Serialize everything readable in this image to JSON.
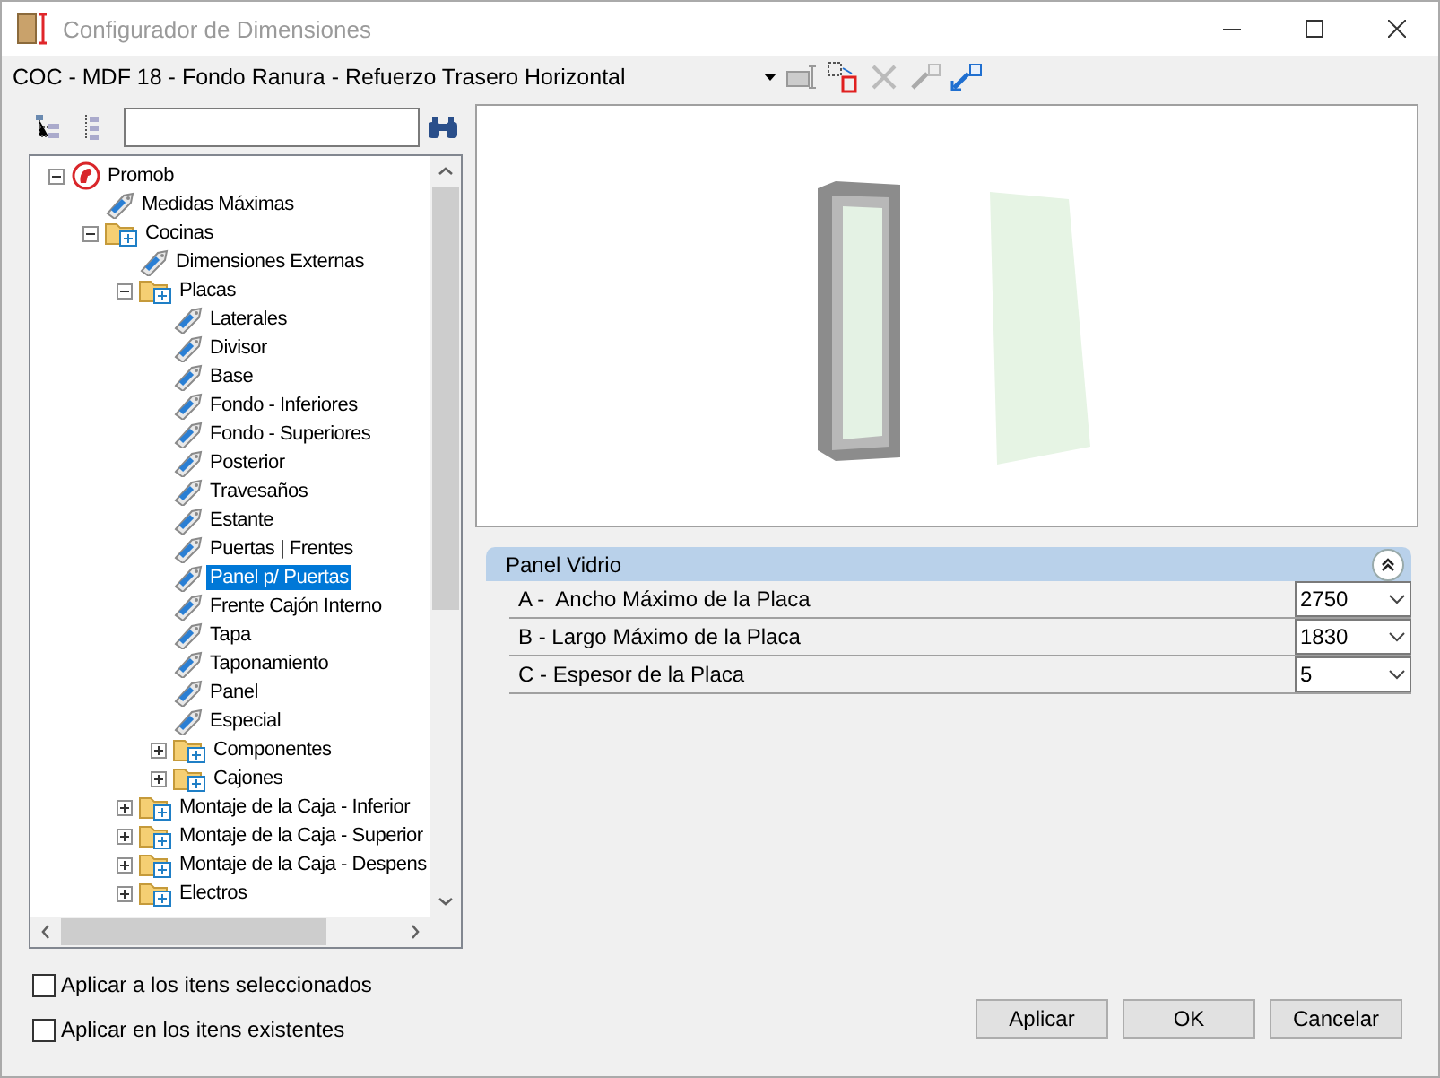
{
  "window": {
    "title": "Configurador de Dimensiones"
  },
  "configuration": {
    "value": "COC - MDF 18 - Fondo Ranura - Refuerzo Trasero Horizontal"
  },
  "tree": {
    "items": [
      {
        "label": "Promob",
        "kind": "root",
        "expanded": true,
        "selected": false,
        "children": [
          {
            "label": "Medidas Máximas",
            "kind": "item",
            "selected": false
          },
          {
            "label": "Cocinas",
            "kind": "folder",
            "expanded": true,
            "selected": false,
            "children": [
              {
                "label": "Dimensiones Externas",
                "kind": "item",
                "selected": false
              },
              {
                "label": "Placas",
                "kind": "folder",
                "expanded": true,
                "selected": false,
                "children": [
                  {
                    "label": "Laterales",
                    "kind": "item",
                    "selected": false
                  },
                  {
                    "label": "Divisor",
                    "kind": "item",
                    "selected": false
                  },
                  {
                    "label": "Base",
                    "kind": "item",
                    "selected": false
                  },
                  {
                    "label": "Fondo - Inferiores",
                    "kind": "item",
                    "selected": false
                  },
                  {
                    "label": "Fondo - Superiores",
                    "kind": "item",
                    "selected": false
                  },
                  {
                    "label": "Posterior",
                    "kind": "item",
                    "selected": false
                  },
                  {
                    "label": "Travesaños",
                    "kind": "item",
                    "selected": false
                  },
                  {
                    "label": "Estante",
                    "kind": "item",
                    "selected": false
                  },
                  {
                    "label": "Puertas | Frentes",
                    "kind": "item",
                    "selected": false
                  },
                  {
                    "label": "Panel p/ Puertas",
                    "kind": "item",
                    "selected": true
                  },
                  {
                    "label": "Frente Cajón Interno",
                    "kind": "item",
                    "selected": false
                  },
                  {
                    "label": "Tapa",
                    "kind": "item",
                    "selected": false
                  },
                  {
                    "label": "Taponamiento",
                    "kind": "item",
                    "selected": false
                  },
                  {
                    "label": "Panel",
                    "kind": "item",
                    "selected": false
                  },
                  {
                    "label": "Especial",
                    "kind": "item",
                    "selected": false
                  },
                  {
                    "label": "Componentes",
                    "kind": "folder",
                    "expanded": false,
                    "selected": false
                  },
                  {
                    "label": "Cajones",
                    "kind": "folder",
                    "expanded": false,
                    "selected": false
                  }
                ]
              },
              {
                "label": "Montaje de la Caja - Inferior",
                "kind": "folder",
                "expanded": false,
                "selected": false
              },
              {
                "label": "Montaje de la Caja - Superior",
                "kind": "folder",
                "expanded": false,
                "selected": false
              },
              {
                "label": "Montaje de la Caja - Despens",
                "kind": "folder",
                "expanded": false,
                "selected": false
              },
              {
                "label": "Electros",
                "kind": "folder",
                "expanded": false,
                "selected": false
              }
            ]
          }
        ]
      }
    ]
  },
  "property_group": {
    "title": "Panel Vidrio",
    "expanded": true,
    "rows": [
      {
        "label": "A -  Ancho Máximo de la Placa",
        "value": "2750"
      },
      {
        "label": "B - Largo Máximo de la Placa",
        "value": "1830"
      },
      {
        "label": "C - Espesor de la Placa",
        "value": "5"
      }
    ]
  },
  "options": [
    {
      "label": "Aplicar a los itens seleccionados",
      "checked": false
    },
    {
      "label": "Aplicar en los itens existentes",
      "checked": false
    }
  ],
  "buttons": [
    "Aplicar",
    "OK",
    "Cancelar"
  ]
}
